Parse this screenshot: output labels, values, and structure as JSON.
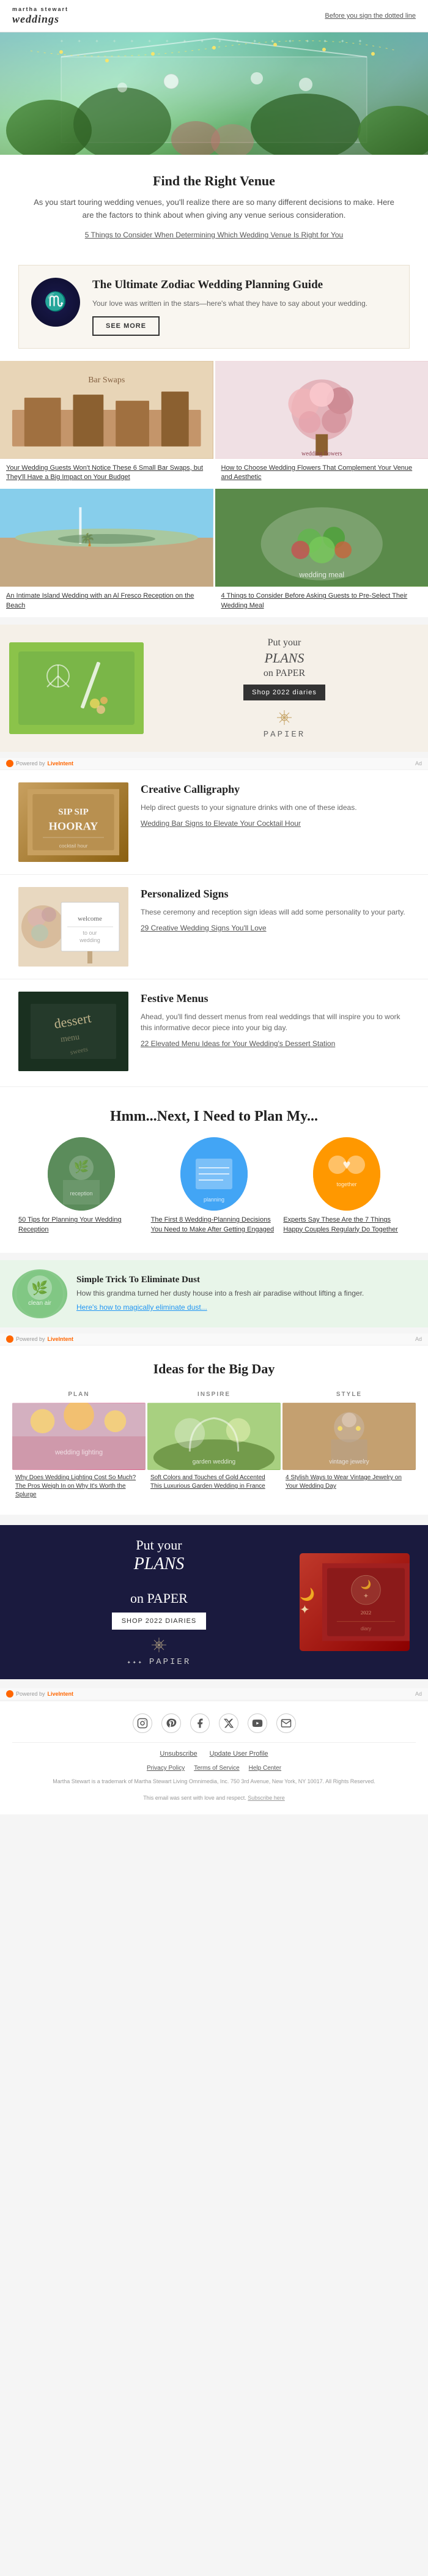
{
  "header": {
    "logo_line1": "MARTHA STEWART",
    "logo_line2": "weddings",
    "nav_link": "Before you sign the dotted line"
  },
  "hero": {
    "alt": "Greenhouse wedding venue with hanging lights"
  },
  "venue_section": {
    "title": "Find the Right Venue",
    "description": "As you start touring wedding venues, you'll realize there are so many different decisions to make. Here are the factors to think about when giving any venue serious consideration.",
    "link_text": "5 Things to Consider When Determining Which Wedding Venue Is Right for You"
  },
  "zodiac": {
    "title": "The Ultimate Zodiac Wedding Planning Guide",
    "description": "Your love was written in the stars—here's what they have to say about your wedding.",
    "button_label": "SEE MORE",
    "icon": "♏"
  },
  "grid_articles": [
    {
      "caption": "Your Wedding Guests Won't Notice These 6 Small Bar Swaps, but They'll Have a Big Impact on Your Budget",
      "img_class": "img-wedding-table"
    },
    {
      "caption": "How to Choose Wedding Flowers That Complement Your Venue and Aesthetic",
      "img_class": "img-bouquet"
    },
    {
      "caption": "An Intimate Island Wedding with an Al Fresco Reception on the Beach",
      "img_class": "img-island"
    },
    {
      "caption": "4 Things to Consider Before Asking Guests to Pre-Select Their Wedding Meal",
      "img_class": "img-salad"
    }
  ],
  "papier_ad1": {
    "plans_line1": "Put your",
    "plans_line2": "PLANS",
    "plans_line3": "on PAPER",
    "button_label": "Shop 2022 diaries",
    "logo": "PAPIER",
    "ad_label": "Ad",
    "powered_by": "Powered by"
  },
  "feature_sections": [
    {
      "title": "Creative Calligraphy",
      "description": "Help direct guests to your signature drinks with one of these ideas.",
      "link_text": "Wedding Bar Signs to Elevate Your Cocktail Hour",
      "img_class": "calligraphy-img",
      "img_text": "SIP SIP\nHOORAY"
    },
    {
      "title": "Personalized Signs",
      "description": "These ceremony and reception sign ideas will add some personality to your party.",
      "link_text": "29 Creative Wedding Signs You'll Love",
      "img_class": "signs-img",
      "img_text": "welcome"
    },
    {
      "title": "Festive Menus",
      "description": "Ahead, you'll find dessert menus from real weddings that will inspire you to work this informative decor piece into your big day.",
      "link_text": "22 Elevated Menu Ideas for Your Wedding's Dessert Station",
      "img_class": "menus-img",
      "img_text": "dessert"
    }
  ],
  "plan_section": {
    "title": "Hmm...Next, I Need to Plan My...",
    "articles": [
      {
        "caption": "50 Tips for Planning Your Wedding Reception",
        "img_class": "img-reception"
      },
      {
        "caption": "The First 8 Wedding-Planning Decisions You Need to Make After Getting Engaged",
        "img_class": "img-planning"
      },
      {
        "caption": "Experts Say These Are the 7 Things Happy Couples Regularly Do Together",
        "img_class": "img-happy"
      }
    ]
  },
  "dust_ad": {
    "title": "Simple Trick To Eliminate Dust",
    "description": "How this grandma turned her dusty house into a fresh air paradise without lifting a finger.",
    "link_text": "Here's how to magically eliminate dust...",
    "ad_label": "Ad",
    "powered_by": "Powered by"
  },
  "big_day_section": {
    "title": "Ideas for the Big Day",
    "columns": [
      {
        "header": "PLAN",
        "caption": "Why Does Wedding Lighting Cost So Much? The Pros Weigh In on Why It's Worth the Splurge",
        "img_class": "img-lights"
      },
      {
        "header": "INSPIRE",
        "caption": "Soft Colors and Touches of Gold Accented This Luxurious Garden Wedding in France",
        "img_class": "img-wedding-color"
      },
      {
        "header": "STYLE",
        "caption": "4 Stylish Ways to Wear Vintage Jewelry on Your Wedding Day",
        "img_class": "img-style"
      }
    ]
  },
  "papier_ad2": {
    "plans_line1": "Put your",
    "plans_line2": "PLANS",
    "plans_line3": "on PAPER",
    "button_label": "Shop 2022 diaries",
    "logo": "PAPIER",
    "ad_label": "Ad",
    "powered_by": "Powered by"
  },
  "social": {
    "icons": [
      {
        "name": "instagram",
        "symbol": "📷"
      },
      {
        "name": "pinterest",
        "symbol": "P"
      },
      {
        "name": "facebook",
        "symbol": "f"
      },
      {
        "name": "twitter",
        "symbol": "𝕏"
      },
      {
        "name": "youtube",
        "symbol": "▶"
      },
      {
        "name": "email",
        "symbol": "✉"
      }
    ]
  },
  "footer": {
    "unsubscribe": "Unsubscribe",
    "update_profile": "Update User Profile",
    "links": [
      "Privacy Policy",
      "Terms of Service",
      "Help Center"
    ],
    "legal_text": "Martha Stewart is a trademark of Martha Stewart Living Omnimedia, Inc. 750 3rd Avenue, New York, NY 10017. All Rights Reserved.",
    "address": "750 3rd Avenue, New York, NY 10017",
    "subscribe_link": "Subscribe here"
  }
}
